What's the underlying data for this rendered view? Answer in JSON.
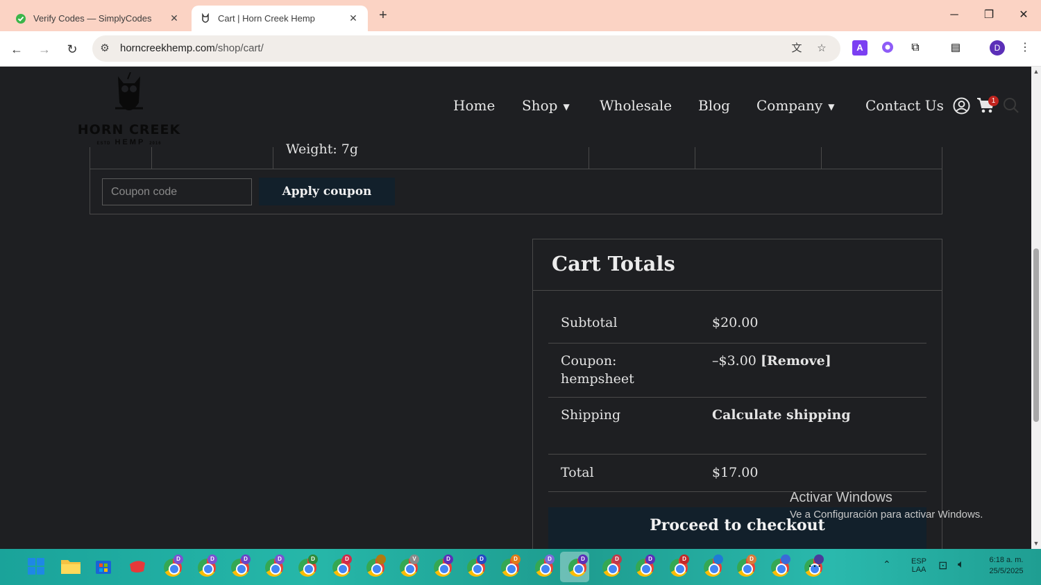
{
  "browser": {
    "tabs": [
      {
        "title": "Verify Codes — SimplyCodes",
        "active": false
      },
      {
        "title": "Cart | Horn Creek Hemp",
        "active": true
      }
    ],
    "url": {
      "host": "horncreekhemp.com",
      "path": "/shop/cart/"
    },
    "profile_initial": "D",
    "extension_letter": "A"
  },
  "header": {
    "logo": {
      "brand": "HORN CREEK",
      "sub": "HEMP",
      "estd": "ESTD",
      "year": "2016"
    },
    "nav": {
      "home": "Home",
      "shop": "Shop",
      "wholesale": "Wholesale",
      "blog": "Blog",
      "company": "Company",
      "contact": "Contact Us"
    },
    "cart_count": "1"
  },
  "cart": {
    "weight_line": "Weight: 7g",
    "coupon_placeholder": "Coupon code",
    "apply_coupon": "Apply coupon"
  },
  "totals": {
    "heading": "Cart Totals",
    "subtotal_label": "Subtotal",
    "subtotal_value": "$20.00",
    "coupon_label": "Coupon:",
    "coupon_code": "hempsheet",
    "coupon_value": "–$3.00",
    "coupon_remove": "[Remove]",
    "shipping_label": "Shipping",
    "shipping_value": "Calculate shipping",
    "total_label": "Total",
    "total_value": "$17.00",
    "checkout": "Proceed to checkout"
  },
  "watermark": {
    "title": "Activar Windows",
    "subtitle": "Ve a Configuración para activar Windows."
  },
  "taskbar": {
    "language": "ESP",
    "layout": "LAA",
    "time": "6:18 a. m.",
    "date": "25/5/2025",
    "chrome_profiles": [
      "D",
      "D",
      "D",
      "D",
      "D",
      "D",
      "",
      "V",
      "D",
      "D",
      "D",
      "D",
      "D",
      "D",
      "D",
      "D",
      "",
      "D",
      "",
      ""
    ]
  },
  "colors": {
    "tabstrip": "#fbd3c4",
    "page_bg": "#1e1f22",
    "button_bg": "#12202b",
    "badge_red": "#c0241e",
    "profile_purple": "#5b2fb8"
  }
}
